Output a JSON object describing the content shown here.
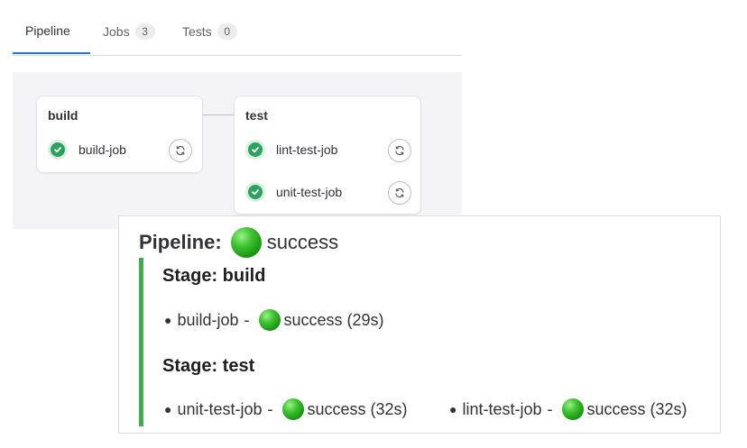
{
  "tabs": [
    {
      "label": "Pipeline",
      "active": true
    },
    {
      "label": "Jobs",
      "count": "3"
    },
    {
      "label": "Tests",
      "count": "0"
    }
  ],
  "graph": {
    "stages": [
      {
        "title": "build",
        "jobs": [
          {
            "name": "build-job",
            "status": "success"
          }
        ]
      },
      {
        "title": "test",
        "jobs": [
          {
            "name": "lint-test-job",
            "status": "success"
          },
          {
            "name": "unit-test-job",
            "status": "success"
          }
        ]
      }
    ]
  },
  "summary": {
    "pipeline_label": "Pipeline:",
    "pipeline_status": "success",
    "stages": [
      {
        "heading": "Stage: build",
        "jobs": [
          {
            "name": "build-job",
            "sep": "-",
            "status": "success (29s)"
          }
        ]
      },
      {
        "heading": "Stage: test",
        "jobs": [
          {
            "name": "unit-test-job",
            "sep": "-",
            "status": "success (32s)"
          },
          {
            "name": "lint-test-job",
            "sep": "-",
            "status": "success (32s)"
          }
        ]
      }
    ]
  },
  "colors": {
    "success": "#2da160",
    "accent": "#1f75cb",
    "status_ball": "#3fc430",
    "stage_bar": "#3fae4e"
  },
  "icons": {
    "job_status": "check-circle-icon",
    "job_action": "retry-icon",
    "summary_status": "green-ball-icon"
  }
}
